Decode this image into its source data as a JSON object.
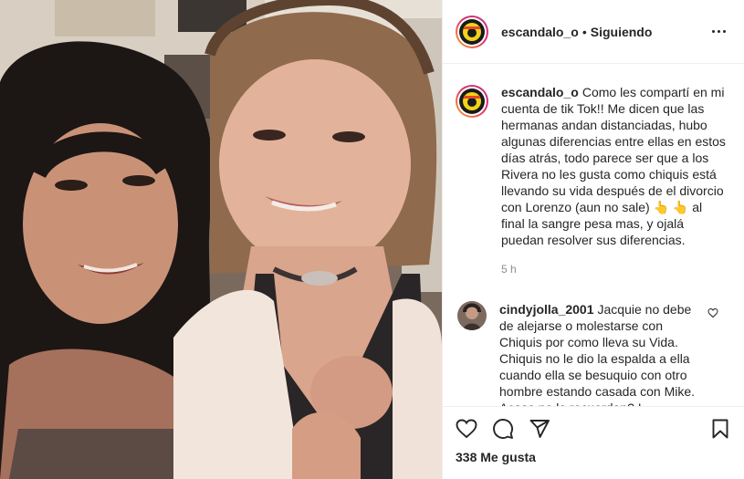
{
  "header": {
    "username": "escandalo_o",
    "separator": "•",
    "follow_status": "Siguiendo"
  },
  "caption": {
    "username": "escandalo_o",
    "text_1": "Como les compartí en mi cuenta de tik Tok!! Me dicen que las hermanas andan distanciadas, hubo algunas diferencias entre ellas en estos días atrás, todo parece ser que a los Rivera no les gusta como chiquis está llevando su vida después de el divorcio con Lorenzo (aun no sale)",
    "emoji_1": "👆",
    "emoji_2": "👆",
    "text_2": "al final la sangre pesa mas, y ojalá puedan resolver sus diferencias.",
    "time": "5 h"
  },
  "comments": [
    {
      "username": "cindyjolla_2001",
      "text": "Jacquie no debe de alejarse o molestarse con Chiquis por como lleva su Vida. Chiquis no le dio la espalda a ella cuando ella se besuquio con otro hombre estando casada con Mike. Acaso no lo recuerdan? !"
    }
  ],
  "footer": {
    "likes": "338 Me gusta"
  },
  "icons": {
    "like": "heart-icon",
    "comment": "comment-icon",
    "share": "send-icon",
    "save": "bookmark-icon",
    "more": "more-icon"
  },
  "colors": {
    "text": "#262626",
    "muted": "#8e8e8e",
    "border": "#efefef",
    "story_ring_start": "#f9a72a",
    "story_ring_end": "#c13584"
  }
}
